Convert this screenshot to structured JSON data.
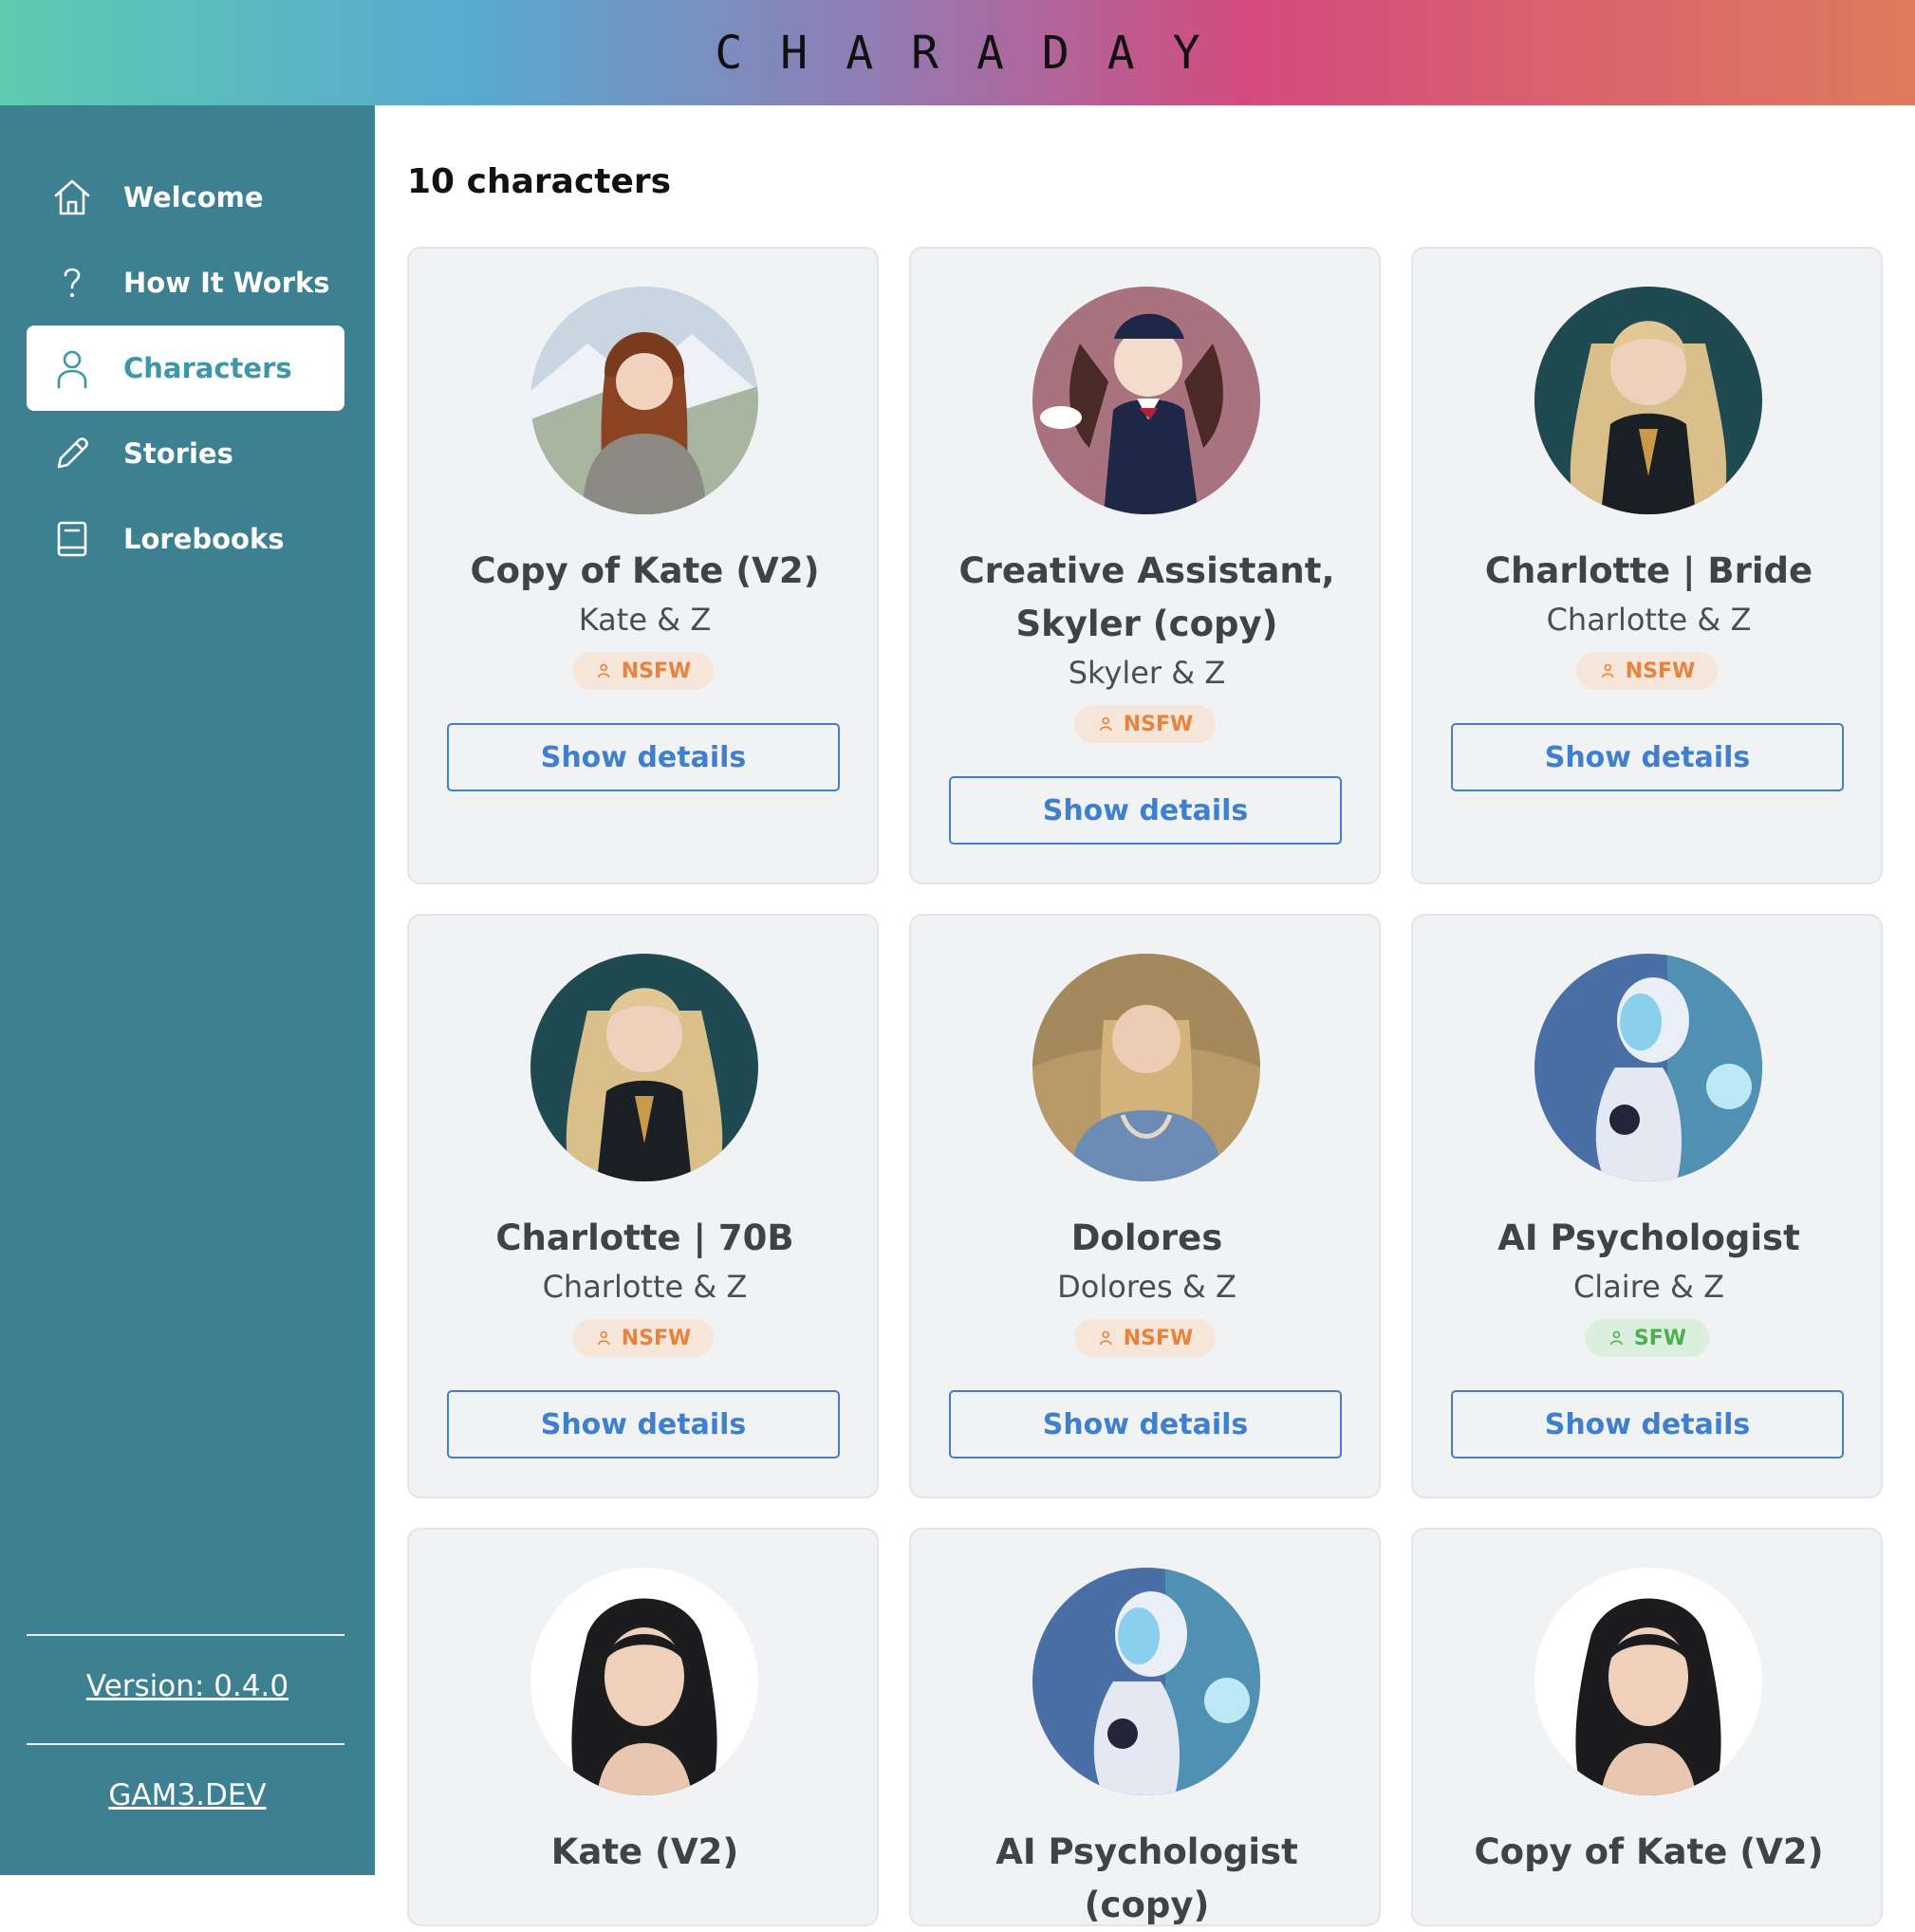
{
  "header": {
    "logo": "CHARADAY"
  },
  "sidebar": {
    "items": [
      {
        "label": "Welcome",
        "icon": "home-icon"
      },
      {
        "label": "How It Works",
        "icon": "question-icon"
      },
      {
        "label": "Characters",
        "icon": "user-icon",
        "active": true
      },
      {
        "label": "Stories",
        "icon": "pencil-icon"
      },
      {
        "label": "Lorebooks",
        "icon": "book-icon"
      }
    ],
    "version": "Version: 0.4.0",
    "site": "GAM3.DEV"
  },
  "main": {
    "count_title": "10 characters",
    "button_label": "Show details",
    "cards": [
      {
        "title": "Copy of Kate (V2)",
        "subtitle": "Kate & Z",
        "badge": "NSFW"
      },
      {
        "title": "Creative Assistant, Skyler (copy)",
        "subtitle": "Skyler & Z",
        "badge": "NSFW"
      },
      {
        "title": "Charlotte | Bride",
        "subtitle": "Charlotte & Z",
        "badge": "NSFW"
      },
      {
        "title": "Charlotte | 70B",
        "subtitle": "Charlotte & Z",
        "badge": "NSFW"
      },
      {
        "title": "Dolores",
        "subtitle": "Dolores & Z",
        "badge": "NSFW"
      },
      {
        "title": "AI Psychologist",
        "subtitle": "Claire & Z",
        "badge": "SFW"
      },
      {
        "title": "Kate (V2)"
      },
      {
        "title": "AI Psychologist (copy)"
      },
      {
        "title": "Copy of Kate (V2)"
      }
    ]
  },
  "colors": {
    "sidebar": "#3d8092",
    "accent": "#3f7fcf",
    "nsfw": "#e9823c",
    "sfw": "#4caf50"
  }
}
